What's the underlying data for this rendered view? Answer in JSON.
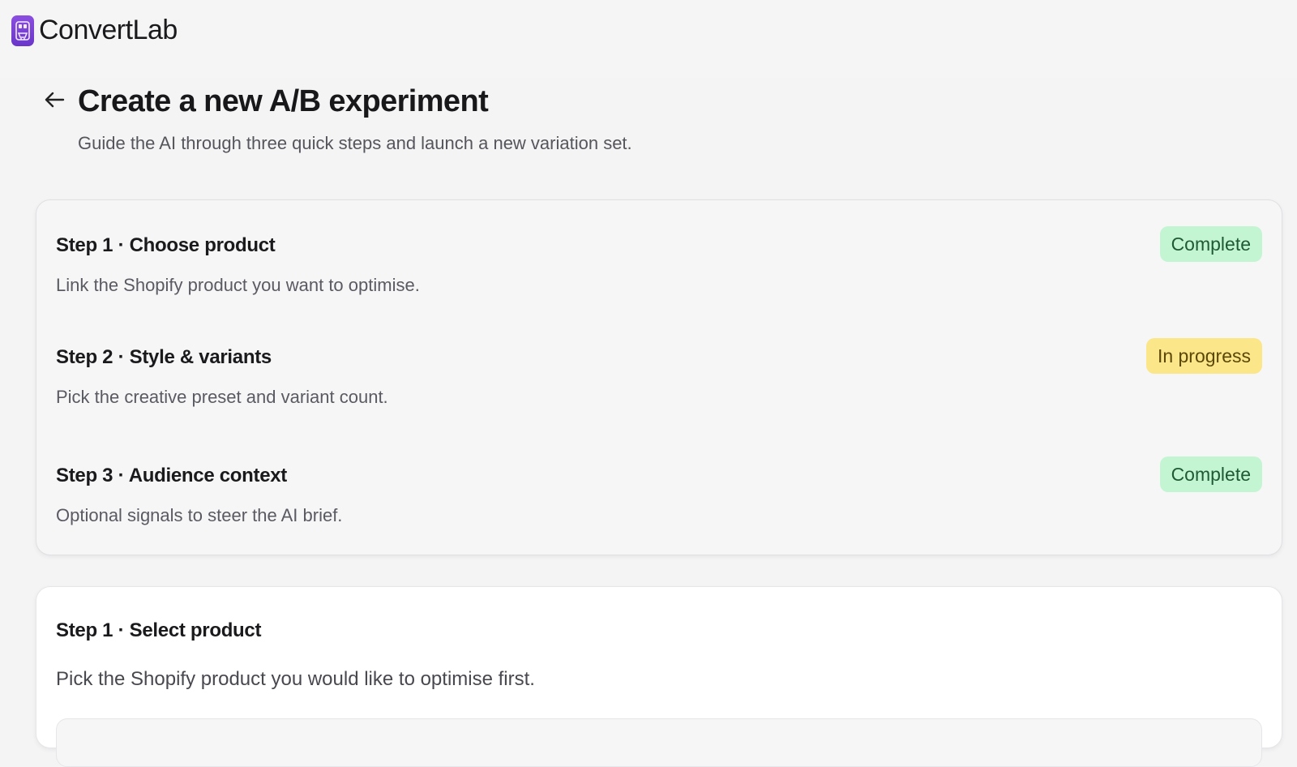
{
  "app": {
    "name": "ConvertLab",
    "logo_icon": "shopping-bag-robot-icon",
    "brand_color": "#7a43d6"
  },
  "header": {
    "back_icon": "arrow-left-icon",
    "title": "Create a new A/B experiment",
    "subtitle": "Guide the AI through three quick steps and launch a new variation set."
  },
  "steps": [
    {
      "title": "Step 1 · Choose product",
      "description": "Link the Shopify product you want to optimise.",
      "status": "Complete"
    },
    {
      "title": "Step 2 · Style & variants",
      "description": "Pick the creative preset and variant count.",
      "status": "In progress"
    },
    {
      "title": "Step 3 · Audience context",
      "description": "Optional signals to steer the AI brief.",
      "status": "Complete"
    }
  ],
  "select_product": {
    "title": "Step 1 · Select product",
    "description": "Pick the Shopify product you would like to optimise first."
  },
  "colors": {
    "complete_bg": "#c4f5d3",
    "in_progress_bg": "#fbe68a"
  }
}
